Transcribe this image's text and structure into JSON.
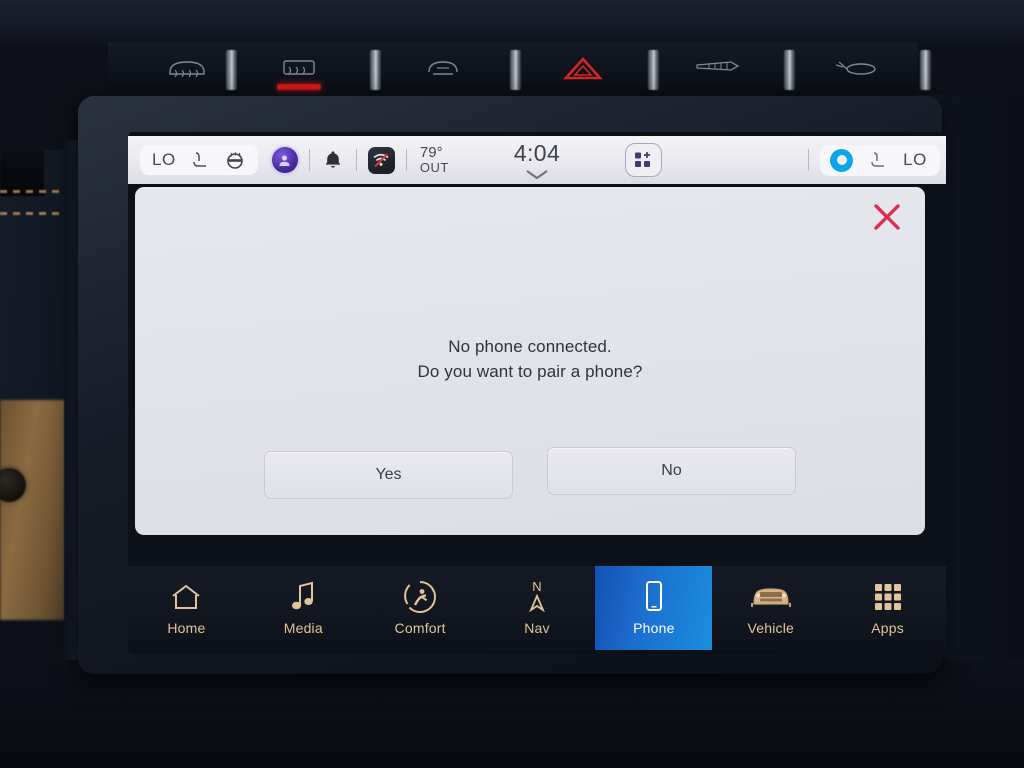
{
  "device": {
    "type": "automotive-infotainment-touchscreen",
    "hvac_buttons": [
      {
        "name": "front-defrost-off-button",
        "indicator": false
      },
      {
        "name": "rear-defrost-button",
        "indicator": true
      },
      {
        "name": "recirculation-button",
        "indicator": false
      },
      {
        "name": "hazard-lights-button",
        "indicator": false
      },
      {
        "name": "fan-speed-button",
        "indicator": false
      },
      {
        "name": "windshield-wiper-button",
        "indicator": false
      }
    ]
  },
  "statusbar": {
    "left_temp_label": "LO",
    "right_temp_label": "LO",
    "outside_temp": "79°",
    "outside_label": "OUT",
    "clock": "4:04",
    "icons": {
      "heated_seat": "heated-seat-icon",
      "heated_steering": "heated-steering-wheel-icon",
      "profile": "user-profile-icon",
      "notifications": "bell-icon",
      "wifi": "wifi-off-icon",
      "grid_add": "grid-add-icon",
      "chevron": "chevron-down-icon",
      "assist": "voice-assistant-icon",
      "passenger_seat": "passenger-heated-seat-icon"
    }
  },
  "dialog": {
    "close_label": "✕",
    "message_line1": "No phone connected.",
    "message_line2": "Do you want to pair a phone?",
    "buttons": [
      {
        "label": "Yes",
        "name": "yes-button"
      },
      {
        "label": "No",
        "name": "no-button"
      }
    ]
  },
  "navbar": {
    "items": [
      {
        "label": "Home",
        "icon": "home-icon",
        "active": false
      },
      {
        "label": "Media",
        "icon": "music-note-icon",
        "active": false
      },
      {
        "label": "Comfort",
        "icon": "comfort-seat-icon",
        "active": false
      },
      {
        "label": "Nav",
        "icon": "compass-north-icon",
        "active": false
      },
      {
        "label": "Phone",
        "icon": "phone-icon",
        "active": true
      },
      {
        "label": "Vehicle",
        "icon": "car-front-icon",
        "active": false
      },
      {
        "label": "Apps",
        "icon": "apps-grid-icon",
        "active": false
      }
    ],
    "nav_north_letter": "N"
  },
  "colors": {
    "accent_blue": "#1b8ede",
    "nav_text_gold": "#e2c49a",
    "close_red": "#d8304f",
    "screen_bg": "#0c1018",
    "dialog_bg": "#e3e3eb"
  }
}
